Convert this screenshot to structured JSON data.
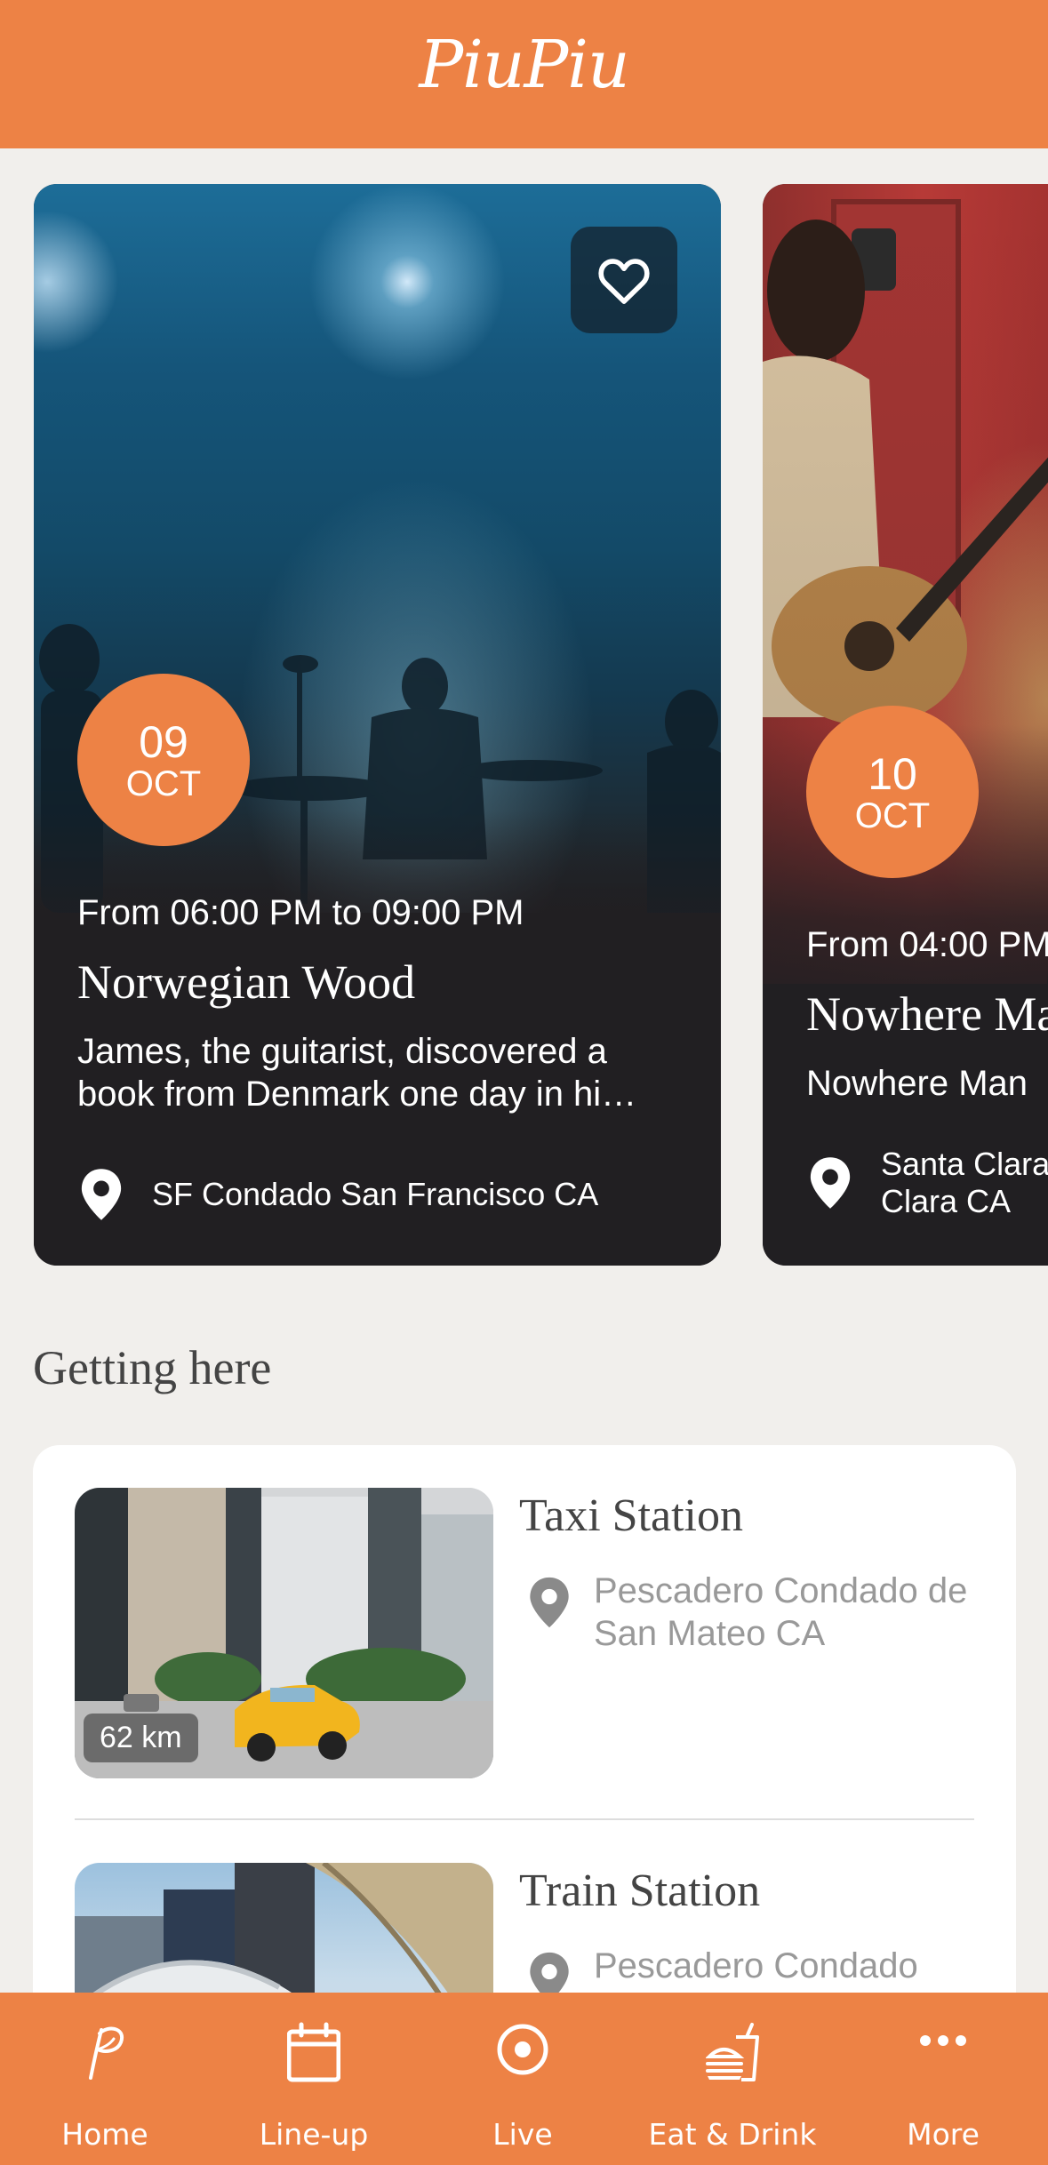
{
  "app": {
    "title": "PiuPiu"
  },
  "colors": {
    "accent": "#ed8245",
    "card_dark": "#211f22",
    "background": "#f1efec"
  },
  "events": [
    {
      "day": "09",
      "month": "OCT",
      "time": "From 06:00 PM to 09:00 PM",
      "title": "Norwegian Wood",
      "description": "James, the guitarist, discovered a book from Denmark one day in hi…",
      "location": "SF Condado San Francisco CA",
      "favorite_icon": "heart-outline-icon"
    },
    {
      "day": "10",
      "month": "OCT",
      "time": "From 04:00 PM",
      "title": "Nowhere Ma",
      "description": "Nowhere Man",
      "location": "Santa Clara\nClara CA"
    }
  ],
  "getting_here": {
    "title": "Getting here",
    "stations": [
      {
        "name": "Taxi Station",
        "address": "Pescadero Condado de San Mateo CA",
        "distance": "62 km"
      },
      {
        "name": "Train Station",
        "address": "Pescadero Condado"
      }
    ]
  },
  "tabbar": {
    "items": [
      {
        "label": "Home",
        "icon": "feather-p-icon"
      },
      {
        "label": "Line-up",
        "icon": "calendar-icon"
      },
      {
        "label": "Live",
        "icon": "target-icon"
      },
      {
        "label": "Eat & Drink",
        "icon": "burger-drink-icon"
      },
      {
        "label": "More",
        "icon": "more-dots-icon"
      }
    ]
  }
}
